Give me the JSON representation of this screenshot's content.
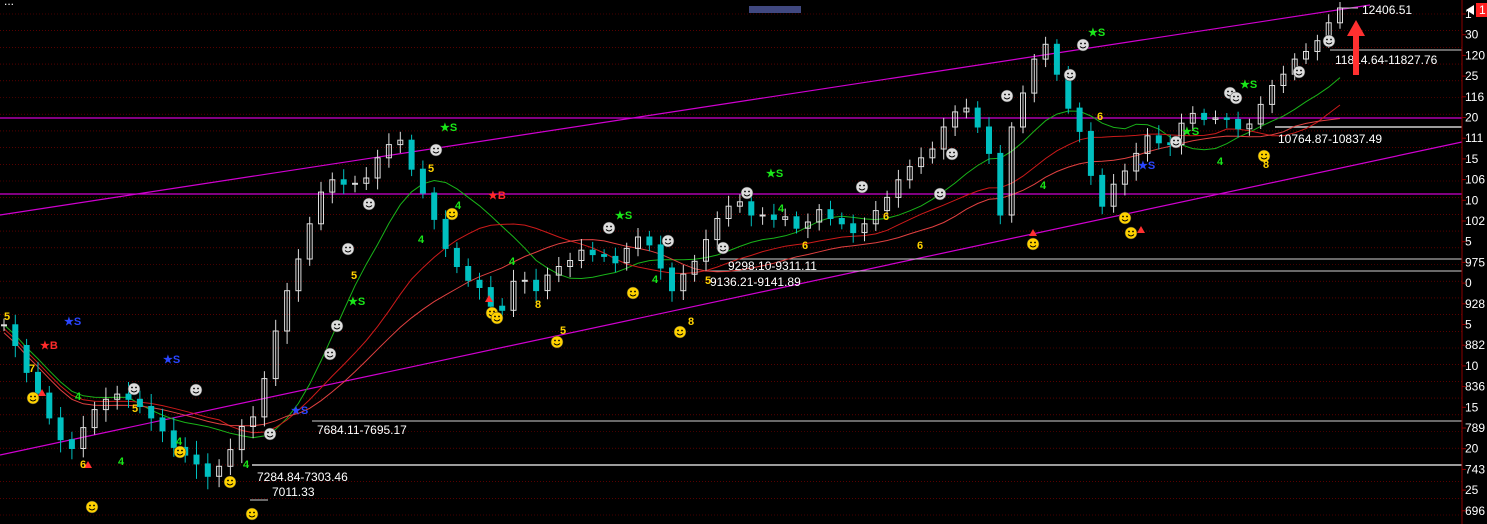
{
  "header": {
    "title_fragment": "...",
    "badge_left": "1"
  },
  "colors": {
    "background": "#000000",
    "grid": "#8b0000",
    "channel": "#d000d0",
    "resistance": "#d000d0",
    "ma_green": "#19b319",
    "ma_red_1": "#cc1a1a",
    "ma_red_2": "#e04040",
    "up_candle": "#dddddd",
    "down_candle": "#00c0c0",
    "marker_yellow": "#ffd200",
    "signal_green": "#19e619",
    "signal_blue": "#2a46ff",
    "signal_red": "#ff2a2a",
    "arrow_red": "#ff3030"
  },
  "chart_data": {
    "type": "candlestick",
    "price_annotations": {
      "high": "12406.51",
      "low": "7011.33"
    },
    "ranges": [
      {
        "label": "11814.64-11827.76"
      },
      {
        "label": "10764.87-10837.49"
      },
      {
        "label": "9298.10-9311.11"
      },
      {
        "label": "9136.21-9141.89"
      },
      {
        "label": "7684.11-7695.17"
      },
      {
        "label": "7284.84-7303.46"
      }
    ],
    "y_tick_labels": [
      "1",
      "30",
      "120",
      "25",
      "116",
      "20",
      "111",
      "15",
      "106",
      "10",
      "102",
      "5",
      "975",
      "0",
      "928",
      "5",
      "882",
      "10",
      "836",
      "15",
      "789",
      "20",
      "743",
      "25",
      "696"
    ],
    "close_series": [
      8620,
      8420,
      8160,
      7960,
      7720,
      7520,
      7440,
      7630,
      7800,
      7900,
      7950,
      7900,
      7830,
      7720,
      7600,
      7450,
      7380,
      7300,
      7200,
      7280,
      7430,
      7640,
      7730,
      8100,
      8560,
      8950,
      9300,
      9700,
      10060,
      10200,
      10150,
      10160,
      10220,
      10450,
      10600,
      10650,
      10320,
      10050,
      9750,
      9420,
      9200,
      9050,
      8980,
      8800,
      8760,
      9040,
      9050,
      8950,
      9100,
      9200,
      9280,
      9400,
      9350,
      9330,
      9250,
      9420,
      9550,
      9460,
      9180,
      8950,
      9110,
      9270,
      9520,
      9760,
      9900,
      9950,
      9800,
      9800,
      9750,
      9780,
      9650,
      9720,
      9860,
      9760,
      9700,
      9600,
      9700,
      9850,
      10000,
      10200,
      10350,
      10450,
      10550,
      10800,
      11000,
      11050,
      10800,
      10500,
      9800,
      10800,
      11250,
      11700,
      11900,
      11500,
      11050,
      10750,
      10250,
      9900,
      10150,
      10300,
      10500,
      10700,
      10620,
      10600,
      10850,
      10980,
      10900,
      10920,
      10900,
      10780,
      10840,
      11100,
      11350,
      11500,
      11700,
      11800,
      11950,
      12200,
      12406
    ],
    "signals": [
      {
        "text": "★B"
      },
      {
        "text": "★S"
      },
      {
        "text": "★B"
      },
      {
        "text": "★S"
      },
      {
        "text": "★B"
      }
    ]
  }
}
